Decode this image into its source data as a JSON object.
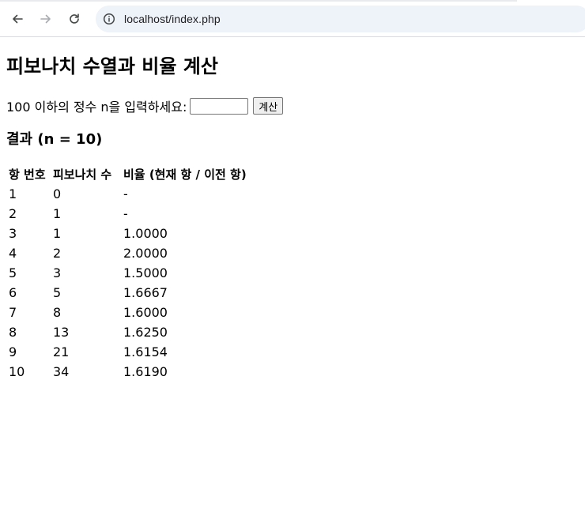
{
  "browser": {
    "url": "localhost/index.php",
    "icons": {
      "back": "arrow-left-icon",
      "forward": "arrow-right-icon",
      "reload": "reload-icon",
      "site_info": "info-circle-icon"
    }
  },
  "page": {
    "title": "피보나치 수열과 비율 계산",
    "form": {
      "label": "100 이하의 정수 n을 입력하세요:",
      "input_value": "",
      "button_label": "계산"
    },
    "result_heading": "결과 (n = 10)",
    "table": {
      "headers": [
        "항 번호",
        "피보나치 수",
        "비율 (현재 항 / 이전 항)"
      ],
      "rows": [
        [
          "1",
          "0",
          "-"
        ],
        [
          "2",
          "1",
          "-"
        ],
        [
          "3",
          "1",
          "1.0000"
        ],
        [
          "4",
          "2",
          "2.0000"
        ],
        [
          "5",
          "3",
          "1.5000"
        ],
        [
          "6",
          "5",
          "1.6667"
        ],
        [
          "7",
          "8",
          "1.6000"
        ],
        [
          "8",
          "13",
          "1.6250"
        ],
        [
          "9",
          "21",
          "1.6154"
        ],
        [
          "10",
          "34",
          "1.6190"
        ]
      ]
    }
  }
}
